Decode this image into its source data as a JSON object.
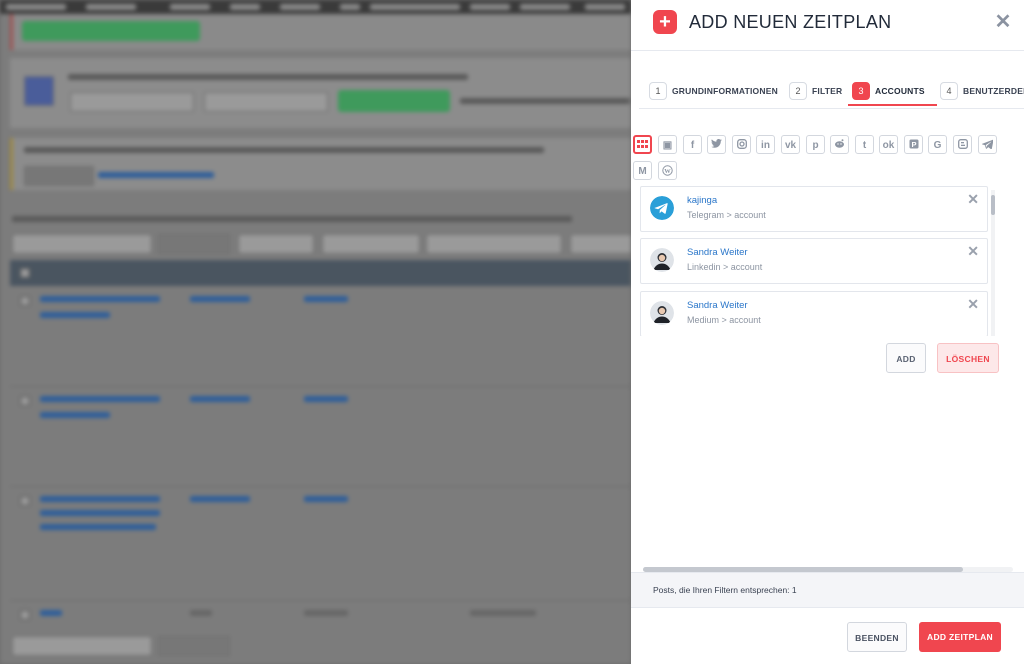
{
  "modal": {
    "title": "ADD NEUEN ZEITPLAN",
    "close_icon": "close-icon",
    "tabs": [
      {
        "num": "1",
        "label": "GRUNDINFORMATIONEN",
        "active": false
      },
      {
        "num": "2",
        "label": "FILTER",
        "active": false
      },
      {
        "num": "3",
        "label": "ACCOUNTS",
        "active": true
      },
      {
        "num": "4",
        "label": "BENUTZERDEFINIERT",
        "active": false
      }
    ],
    "accent_color": "#f0464f",
    "social_icons": [
      {
        "name": "all-networks",
        "glyph": "∷",
        "active": true
      },
      {
        "name": "instagram-story",
        "glyph": "⧉",
        "active": false
      },
      {
        "name": "facebook",
        "glyph": "f",
        "active": false
      },
      {
        "name": "twitter",
        "glyph": "t",
        "active": false
      },
      {
        "name": "instagram",
        "glyph": "◎",
        "active": false
      },
      {
        "name": "linkedin",
        "glyph": "in",
        "active": false
      },
      {
        "name": "vk",
        "glyph": "vk",
        "active": false
      },
      {
        "name": "pinterest",
        "glyph": "p",
        "active": false
      },
      {
        "name": "reddit",
        "glyph": "●",
        "active": false
      },
      {
        "name": "tumblr",
        "glyph": "t",
        "active": false
      },
      {
        "name": "odnoklassniki",
        "glyph": "ok",
        "active": false
      },
      {
        "name": "plurk",
        "glyph": "P",
        "active": false
      },
      {
        "name": "google-business",
        "glyph": "G",
        "active": false
      },
      {
        "name": "blogger",
        "glyph": "B",
        "active": false
      },
      {
        "name": "telegram",
        "glyph": "➤",
        "active": false
      },
      {
        "name": "medium",
        "glyph": "M",
        "active": false
      },
      {
        "name": "wordpress",
        "glyph": "W",
        "active": false
      }
    ],
    "accounts": [
      {
        "name": "kajinga",
        "sub": "Telegram > account",
        "avatar": "telegram"
      },
      {
        "name": "Sandra Weiter",
        "sub": "Linkedin > account",
        "avatar": "person"
      },
      {
        "name": "Sandra Weiter",
        "sub": "Medium > account",
        "avatar": "person"
      }
    ],
    "add_label": "ADD",
    "delete_label": "LÖSCHEN",
    "footer_info": "Posts, die Ihren Filtern entsprechen: 1",
    "finish_label": "BEENDEN",
    "submit_label": "ADD ZEITPLAN"
  }
}
